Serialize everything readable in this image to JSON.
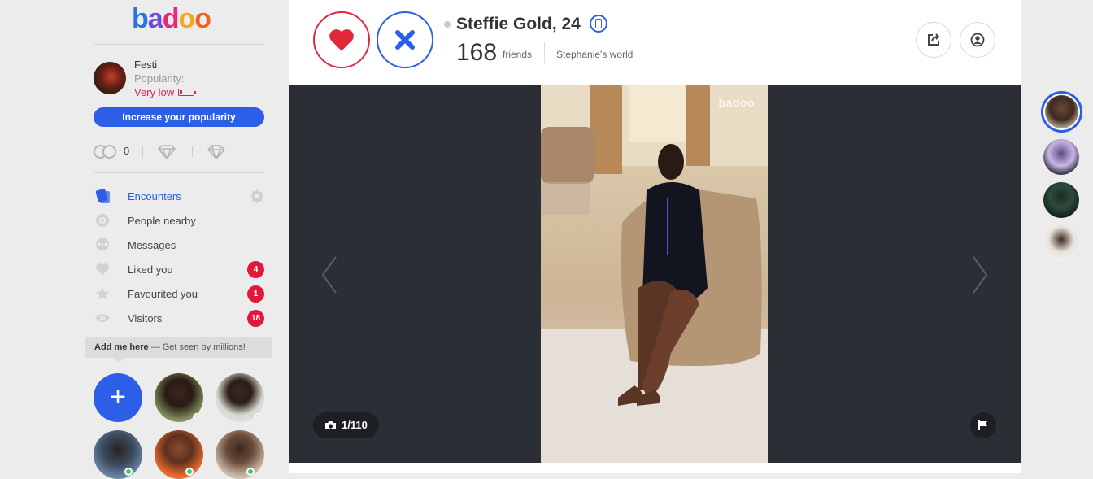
{
  "brand": {
    "logo_letters": [
      "b",
      "a",
      "d",
      "o",
      "o"
    ],
    "colors": {
      "primary": "#2c5ee8",
      "like": "#e0283a",
      "badge": "#e3173a",
      "online": "#3ccb6b"
    }
  },
  "user": {
    "name": "Festi",
    "popularity_label": "Popularity:",
    "popularity_value": "Very low",
    "popularity_level": 0.15
  },
  "increase_button": "Increase your popularity",
  "credits": {
    "count": "0",
    "icons": [
      "coins-icon",
      "super-powers-icon",
      "premium-diamond-icon"
    ]
  },
  "nav": {
    "items": [
      {
        "label": "Encounters",
        "icon": "encounters-cards-icon",
        "active": true,
        "has_settings": true
      },
      {
        "label": "People nearby",
        "icon": "location-target-icon"
      },
      {
        "label": "Messages",
        "icon": "chat-bubble-icon"
      },
      {
        "label": "Liked you",
        "icon": "heart-icon",
        "badge": "4"
      },
      {
        "label": "Favourited you",
        "icon": "star-icon",
        "badge": "1"
      },
      {
        "label": "Visitors",
        "icon": "eye-icon",
        "badge": "18"
      }
    ]
  },
  "add_me": {
    "bold": "Add me here",
    "rest": " — Get seen by millions!"
  },
  "spotlight": {
    "thumbs": [
      {
        "type": "add",
        "label": "+"
      },
      {
        "type": "user",
        "online": true
      },
      {
        "type": "user",
        "online": true
      },
      {
        "type": "user",
        "online": true
      },
      {
        "type": "user",
        "online": true
      },
      {
        "type": "user",
        "online": true
      }
    ]
  },
  "profile": {
    "name_age": "Steffie Gold, 24",
    "friends_count": "168",
    "friends_label": "friends",
    "world_label": "Stephanie's world",
    "photo_counter": "1/110",
    "watermark": "badoo"
  },
  "queue": {
    "count": 4
  }
}
